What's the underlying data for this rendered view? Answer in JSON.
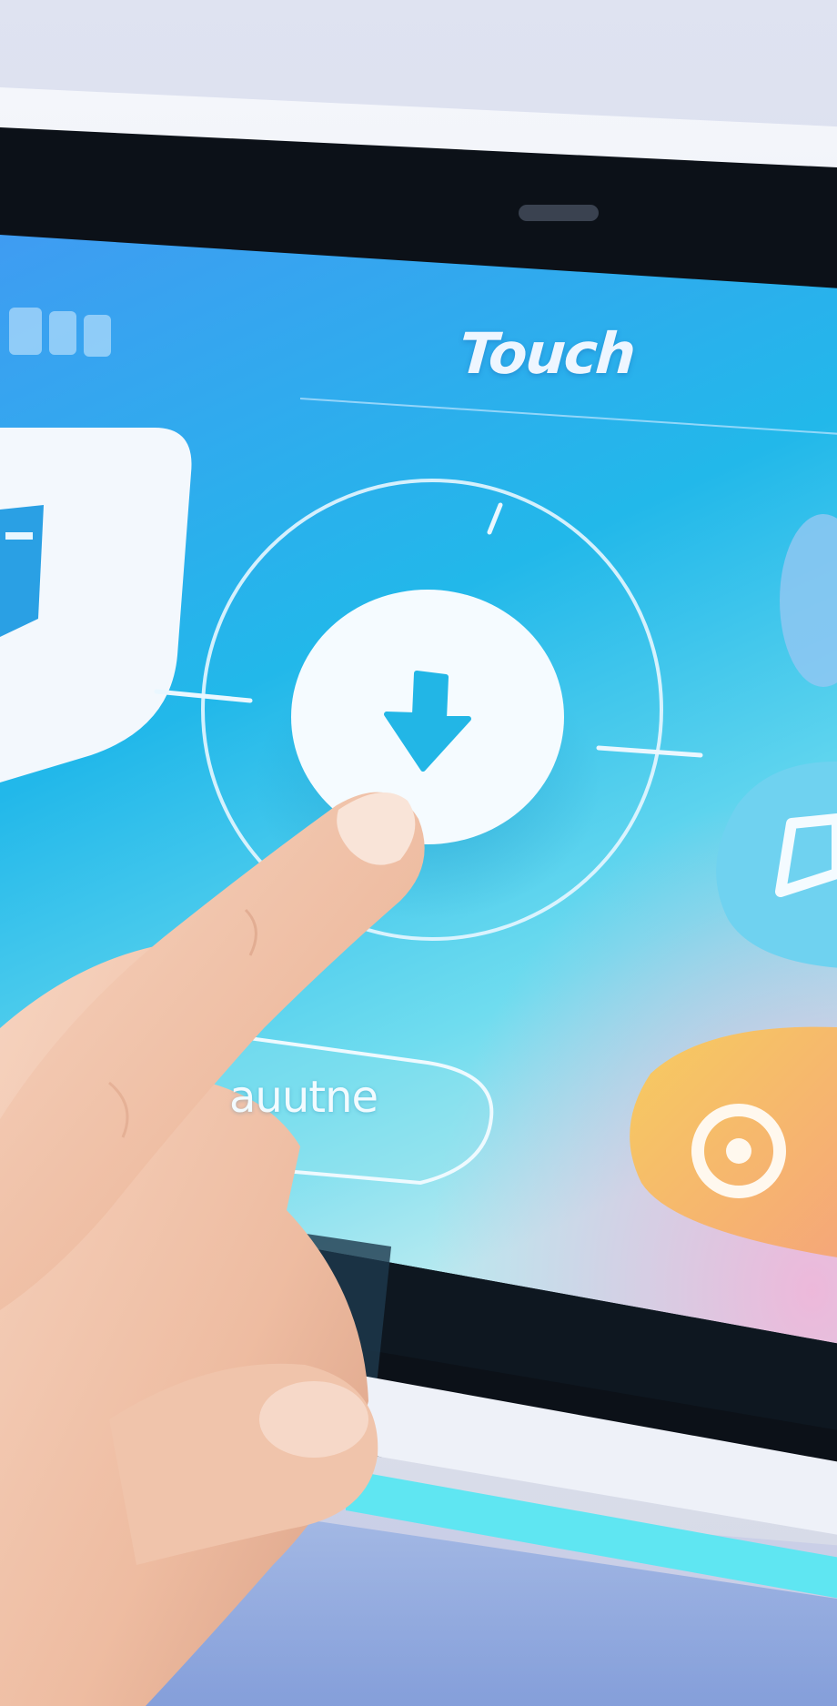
{
  "screen": {
    "title": "Touch",
    "button_label": "auutne",
    "center_icon": "download-arrow-icon",
    "left_card_icon": "document-icon",
    "right_tile_icons": [
      "circle-icon",
      "window-icon",
      "target-icon"
    ]
  },
  "colors": {
    "screen_top": "#3f9cf2",
    "screen_mid": "#22b8ea",
    "screen_bottom": "#8fe6ef",
    "accent_icon": "#22b6e6",
    "tile_orange": "#f6bd62",
    "tile_blue": "#6fd2f0",
    "device_bezel": "#0c1118",
    "device_frame": "#e9edf5",
    "skin": "#f1c7ae"
  }
}
